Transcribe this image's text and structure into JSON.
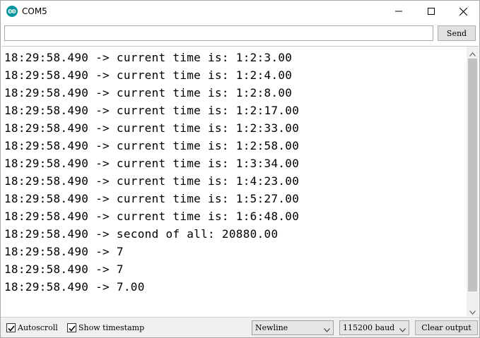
{
  "window": {
    "title": "COM5"
  },
  "send_bar": {
    "input_value": "",
    "send_label": "Send"
  },
  "output": {
    "lines": [
      "18:29:58.490 -> current time is: 1:2:3.00",
      "18:29:58.490 -> current time is: 1:2:4.00",
      "18:29:58.490 -> current time is: 1:2:8.00",
      "18:29:58.490 -> current time is: 1:2:17.00",
      "18:29:58.490 -> current time is: 1:2:33.00",
      "18:29:58.490 -> current time is: 1:2:58.00",
      "18:29:58.490 -> current time is: 1:3:34.00",
      "18:29:58.490 -> current time is: 1:4:23.00",
      "18:29:58.490 -> current time is: 1:5:27.00",
      "18:29:58.490 -> current time is: 1:6:48.00",
      "18:29:58.490 -> second of all: 20880.00",
      "18:29:58.490 -> 7",
      "18:29:58.490 -> 7",
      "18:29:58.490 -> 7.00"
    ]
  },
  "bottom_bar": {
    "autoscroll_label": "Autoscroll",
    "autoscroll_checked": true,
    "timestamp_label": "Show timestamp",
    "timestamp_checked": true,
    "line_ending_selected": "Newline",
    "baud_selected": "115200 baud",
    "clear_label": "Clear output"
  },
  "icons": {
    "app": "arduino-icon",
    "minimize": "minimize-icon",
    "maximize": "maximize-icon",
    "close": "close-icon"
  },
  "colors": {
    "app_icon": "#00979c",
    "scrollbar_thumb": "#c1c1c1"
  }
}
